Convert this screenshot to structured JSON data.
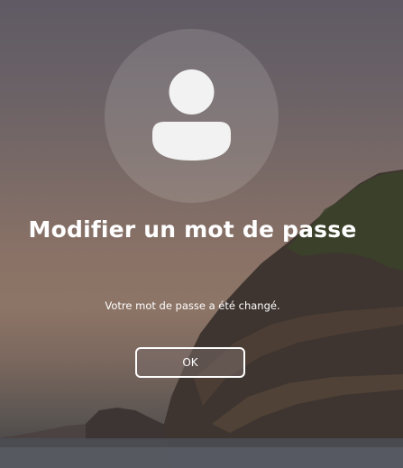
{
  "dialog": {
    "title": "Modifier un mot de passe",
    "message": "Votre mot de passe a été changé.",
    "ok_label": "OK"
  },
  "avatar": {
    "icon": "user-silhouette-icon"
  },
  "background": {
    "description_colors": [
      "#5f5a64",
      "#8c7466",
      "#3c3d41"
    ]
  }
}
